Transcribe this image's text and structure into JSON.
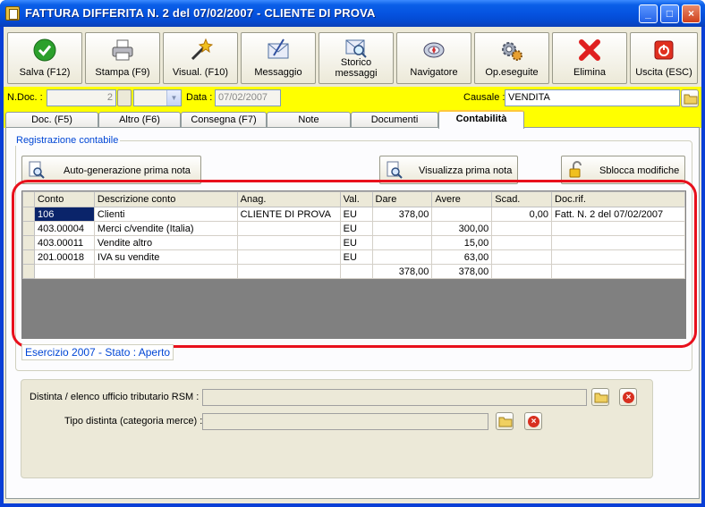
{
  "window": {
    "title": "FATTURA DIFFERITA N. 2  del 07/02/2007 - CLIENTE DI PROVA",
    "minimize": "_",
    "maximize": "□",
    "close": "×"
  },
  "toolbar": [
    {
      "name": "salva",
      "label": "Salva (F12)",
      "icon": "checkmark-icon",
      "color": "#2ca02c"
    },
    {
      "name": "stampa",
      "label": "Stampa (F9)",
      "icon": "printer-icon",
      "color": "#8a8a8a"
    },
    {
      "name": "visual",
      "label": "Visual. (F10)",
      "icon": "magic-wand-icon",
      "color": "#e8a010"
    },
    {
      "name": "messaggio",
      "label": "Messaggio",
      "icon": "mail-icon",
      "color": "#5070c0"
    },
    {
      "name": "storico",
      "label_line1": "Storico",
      "label_line2": "messaggi",
      "icon": "mail-search-icon",
      "color": "#5070c0"
    },
    {
      "name": "navigatore",
      "label": "Navigatore",
      "icon": "compass-icon",
      "color": "#3a60c0"
    },
    {
      "name": "opeseguite",
      "label": "Op.eseguite",
      "icon": "gears-icon",
      "color": "#607090"
    },
    {
      "name": "elimina",
      "label": "Elimina",
      "icon": "red-x-icon",
      "color": "#e02020"
    },
    {
      "name": "uscita",
      "label": "Uscita (ESC)",
      "icon": "power-icon",
      "color": "#e03020"
    }
  ],
  "header": {
    "ndoc_label": "N.Doc. :",
    "ndoc_value": "2",
    "data_label": "Data :",
    "data_value": "07/02/2007",
    "causale_label": "Causale :",
    "causale_value": "VENDITA"
  },
  "tabs": [
    "Doc. (F5)",
    "Altro (F6)",
    "Consegna (F7)",
    "Note",
    "Documenti",
    "Contabilità"
  ],
  "active_tab": "Contabilità",
  "registrazione": {
    "group_title": "Registrazione contabile",
    "btn_autogen": "Auto-generazione prima nota",
    "btn_visualizza": "Visualizza prima nota",
    "btn_sblocca": "Sblocca modifiche"
  },
  "grid": {
    "columns": [
      "Conto",
      "Descrizione conto",
      "Anag.",
      "Val.",
      "Dare",
      "Avere",
      "Scad.",
      "Doc.rif."
    ],
    "rows": [
      [
        "106",
        "Clienti",
        "CLIENTE DI PROVA",
        "EU",
        "378,00",
        "",
        "0,00",
        "Fatt. N. 2 del 07/02/2007"
      ],
      [
        "403.00004",
        "Merci c/vendite (Italia)",
        "",
        "EU",
        "",
        "300,00",
        "",
        ""
      ],
      [
        "403.00011",
        "Vendite altro",
        "",
        "EU",
        "",
        "15,00",
        "",
        ""
      ],
      [
        "201.00018",
        "IVA su vendite",
        "",
        "EU",
        "",
        "63,00",
        "",
        ""
      ],
      [
        "",
        "",
        "",
        "",
        "378,00",
        "378,00",
        "",
        ""
      ]
    ]
  },
  "status": "Esercizio 2007 - Stato : Aperto",
  "bottom": {
    "distinta_label": "Distinta / elenco ufficio tributario RSM :",
    "distinta_value": "",
    "tipo_label": "Tipo distinta (categoria merce) :",
    "tipo_value": ""
  }
}
